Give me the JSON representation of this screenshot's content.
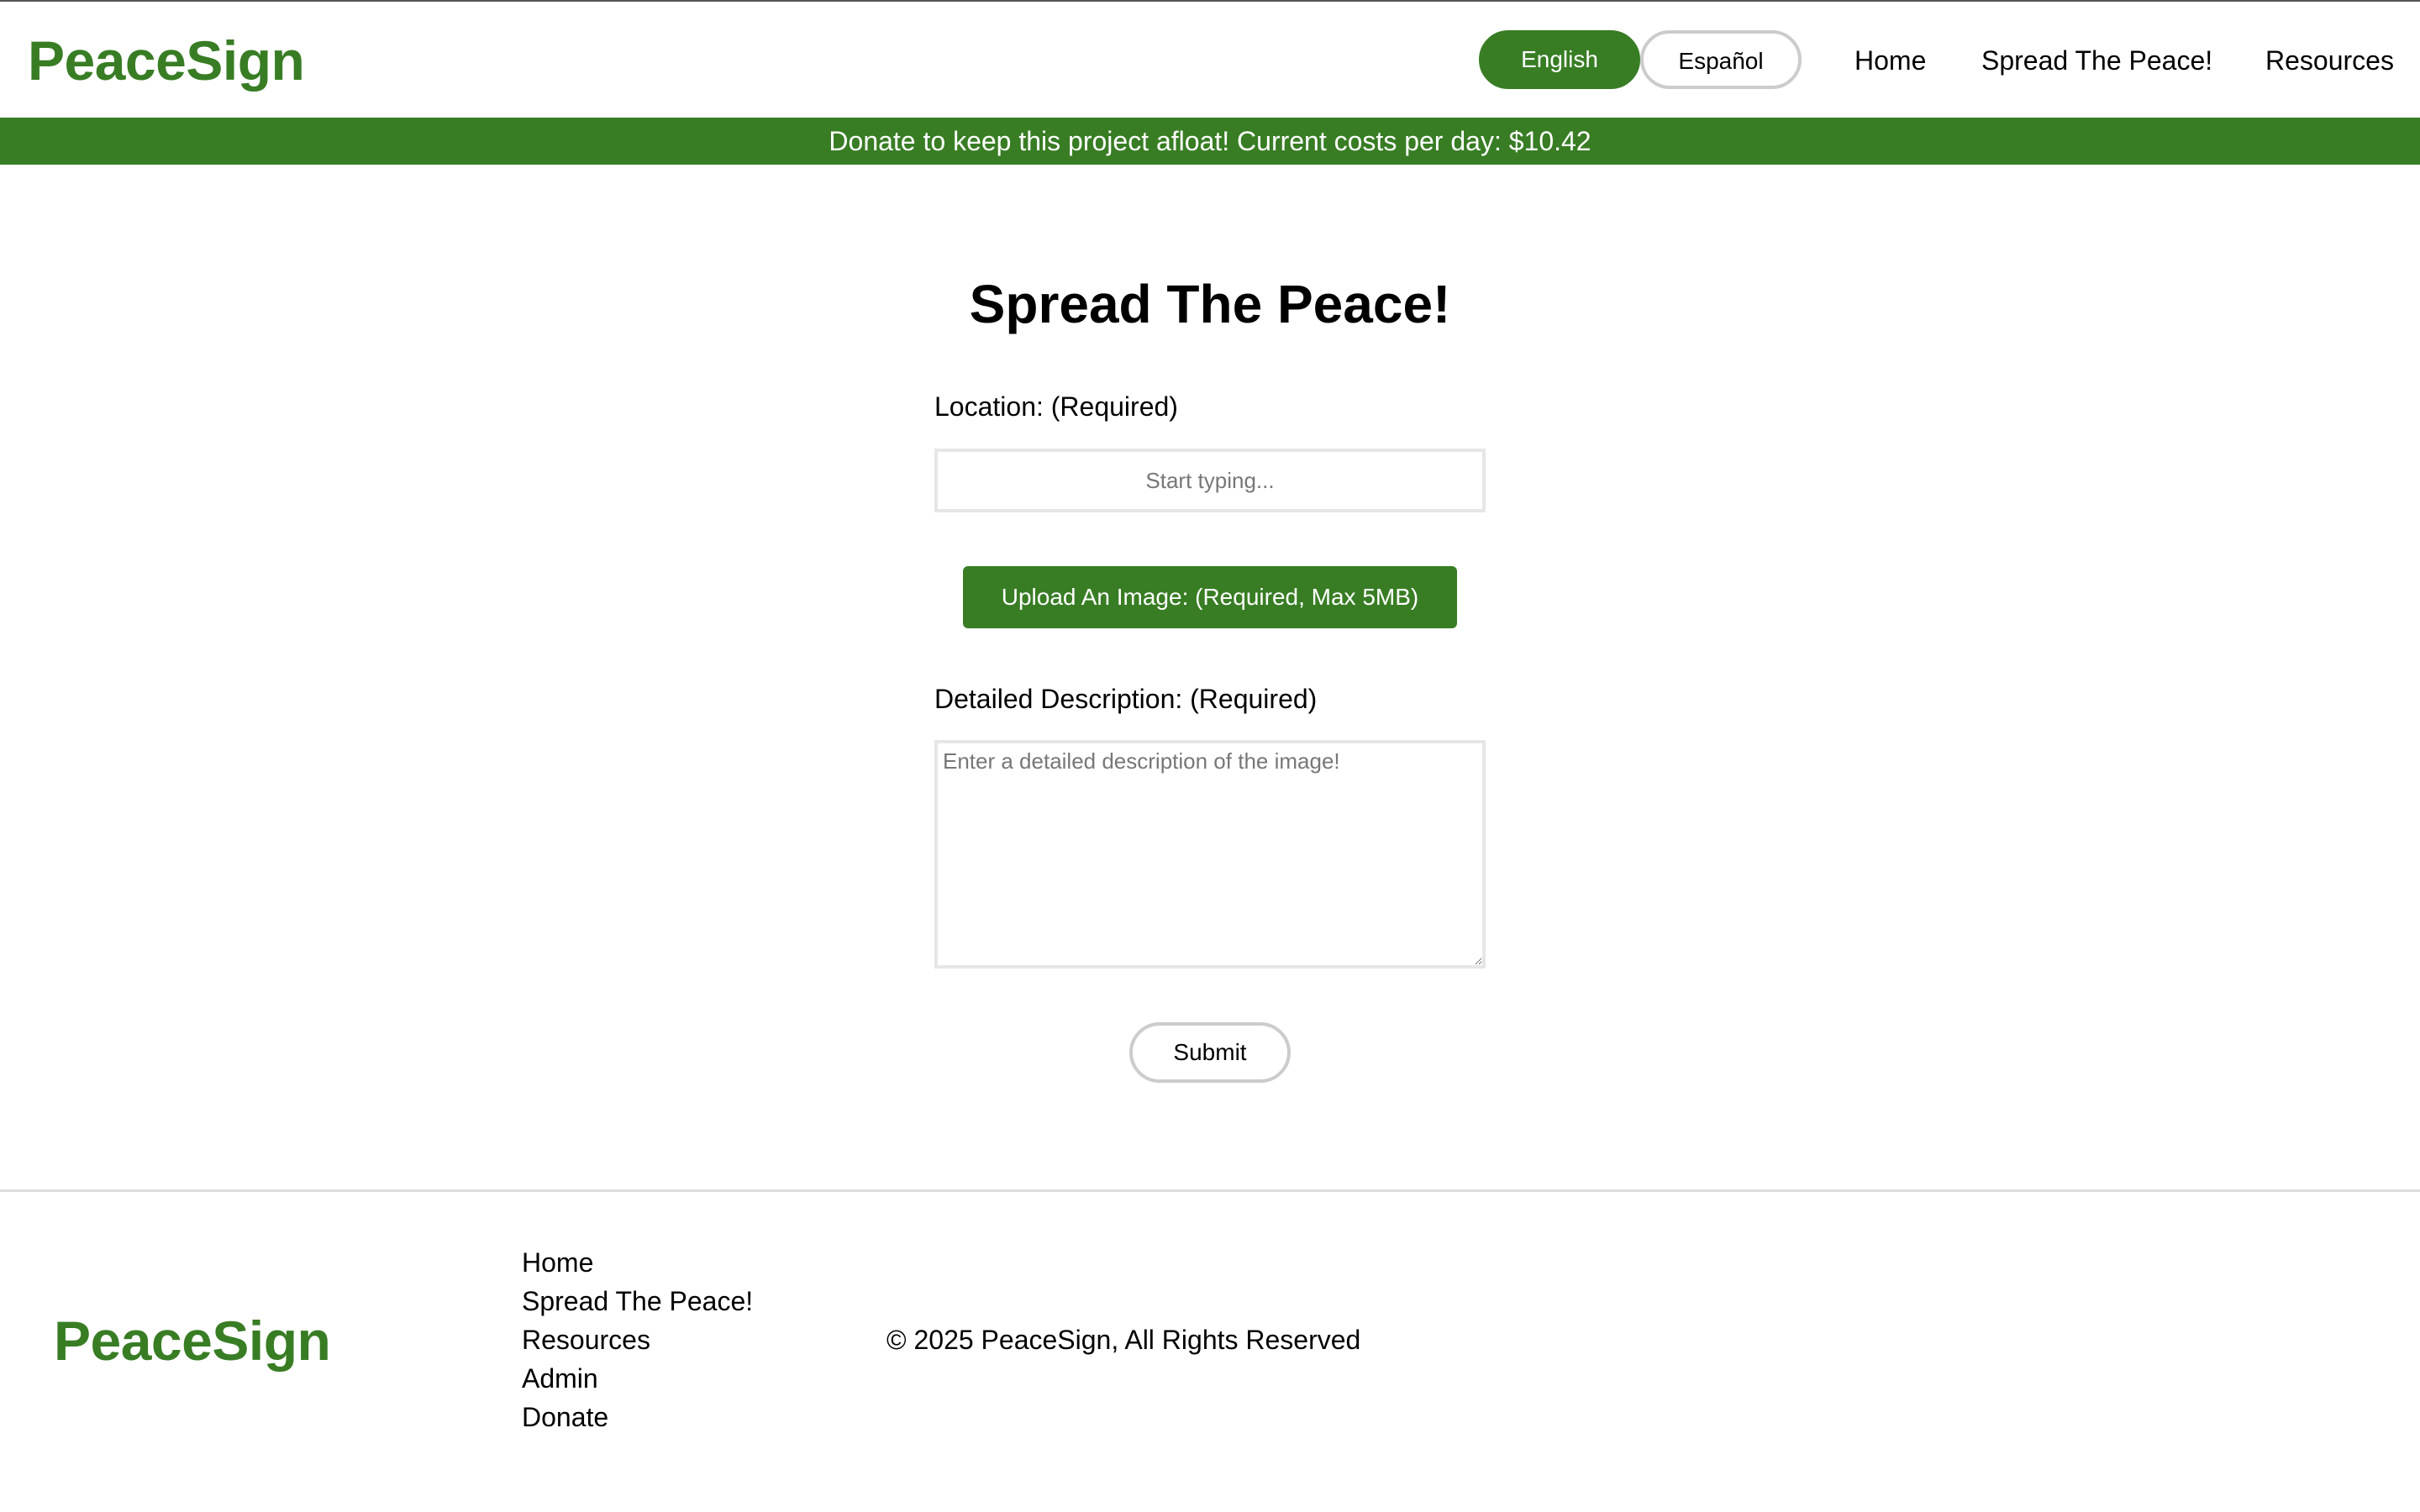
{
  "brand": {
    "name": "PeaceSign",
    "color": "#387d24"
  },
  "header": {
    "languages": {
      "english": "English",
      "spanish": "Español",
      "active": "English"
    },
    "nav": {
      "home": "Home",
      "spread": "Spread The Peace!",
      "resources": "Resources"
    }
  },
  "banner": {
    "text": "Donate to keep this project afloat! Current costs per day: $10.42"
  },
  "form": {
    "title": "Spread The Peace!",
    "location_label": "Location: (Required)",
    "location_placeholder": "Start typing...",
    "location_value": "",
    "upload_label": "Upload An Image: (Required, Max 5MB)",
    "description_label": "Detailed Description: (Required)",
    "description_placeholder": "Enter a detailed description of the image!",
    "description_value": "",
    "submit_label": "Submit"
  },
  "footer": {
    "logo": "PeaceSign",
    "links": {
      "home": "Home",
      "spread": "Spread The Peace!",
      "resources": "Resources",
      "admin": "Admin",
      "donate": "Donate"
    },
    "copyright": "© 2025 PeaceSign, All Rights Reserved"
  },
  "icons": {
    "textarea_resize": "resize-handle-icon"
  }
}
